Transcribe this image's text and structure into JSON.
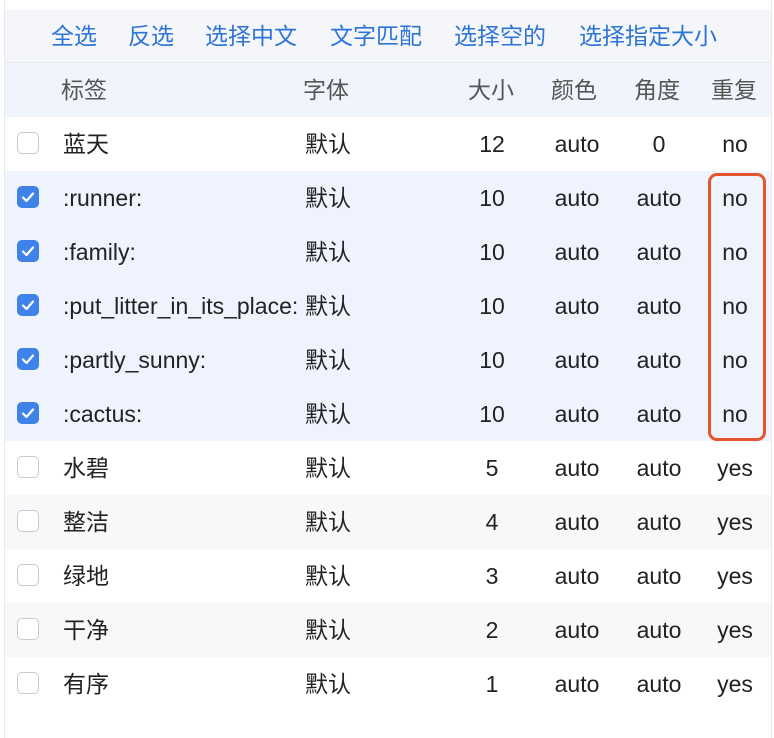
{
  "toolbar": {
    "select_all": "全选",
    "invert_select": "反选",
    "select_chinese": "选择中文",
    "text_match": "文字匹配",
    "select_empty": "选择空的",
    "select_size": "选择指定大小"
  },
  "headers": {
    "label": "标签",
    "font": "字体",
    "size": "大小",
    "color": "颜色",
    "angle": "角度",
    "repeat": "重复"
  },
  "rows": [
    {
      "checked": false,
      "label": "蓝天",
      "font": "默认",
      "size": "12",
      "color": "auto",
      "angle": "0",
      "repeat": "no"
    },
    {
      "checked": true,
      "label": ":runner:",
      "font": "默认",
      "size": "10",
      "color": "auto",
      "angle": "auto",
      "repeat": "no"
    },
    {
      "checked": true,
      "label": ":family:",
      "font": "默认",
      "size": "10",
      "color": "auto",
      "angle": "auto",
      "repeat": "no"
    },
    {
      "checked": true,
      "label": ":put_litter_in_its_place:",
      "font": "默认",
      "size": "10",
      "color": "auto",
      "angle": "auto",
      "repeat": "no"
    },
    {
      "checked": true,
      "label": ":partly_sunny:",
      "font": "默认",
      "size": "10",
      "color": "auto",
      "angle": "auto",
      "repeat": "no"
    },
    {
      "checked": true,
      "label": ":cactus:",
      "font": "默认",
      "size": "10",
      "color": "auto",
      "angle": "auto",
      "repeat": "no"
    },
    {
      "checked": false,
      "label": "水碧",
      "font": "默认",
      "size": "5",
      "color": "auto",
      "angle": "auto",
      "repeat": "yes"
    },
    {
      "checked": false,
      "label": "整洁",
      "font": "默认",
      "size": "4",
      "color": "auto",
      "angle": "auto",
      "repeat": "yes"
    },
    {
      "checked": false,
      "label": "绿地",
      "font": "默认",
      "size": "3",
      "color": "auto",
      "angle": "auto",
      "repeat": "yes"
    },
    {
      "checked": false,
      "label": "干净",
      "font": "默认",
      "size": "2",
      "color": "auto",
      "angle": "auto",
      "repeat": "yes"
    },
    {
      "checked": false,
      "label": "有序",
      "font": "默认",
      "size": "1",
      "color": "auto",
      "angle": "auto",
      "repeat": "yes"
    }
  ],
  "colors": {
    "accent": "#2d74d6",
    "checkbox_checked": "#3f82ea",
    "highlight_border": "#e4552c",
    "selected_row_bg": "#eef3fd"
  }
}
